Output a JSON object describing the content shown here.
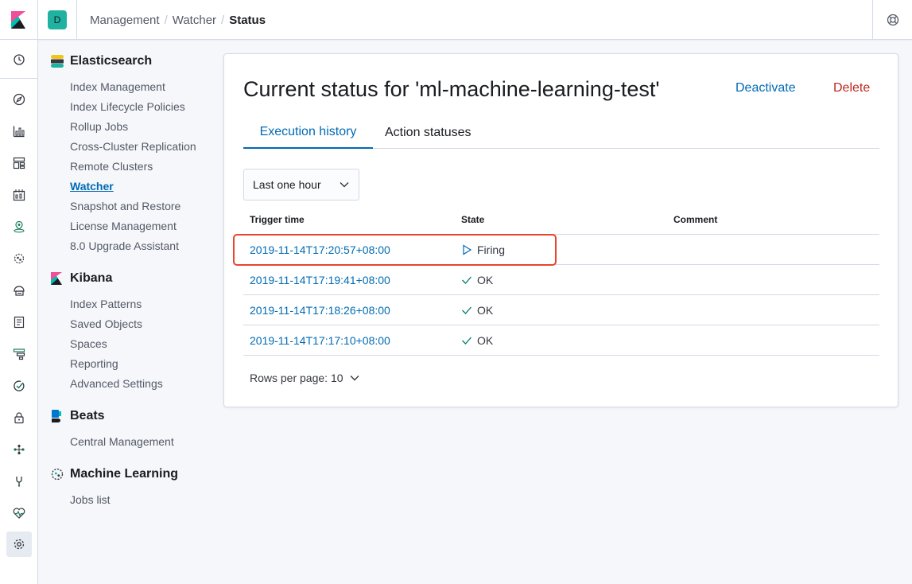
{
  "header": {
    "space_initial": "D",
    "breadcrumbs": [
      "Management",
      "Watcher",
      "Status"
    ],
    "icons": [
      "kibana-logo",
      "help-icon"
    ]
  },
  "iconnav": {
    "items": [
      "clock-icon",
      "discover-icon",
      "visualize-icon",
      "dashboard-icon",
      "canvas-icon",
      "maps-icon",
      "ml-icon",
      "infrastructure-icon",
      "logs-icon",
      "apm-icon",
      "uptime-icon",
      "siem-icon",
      "graph-icon",
      "devtools-icon",
      "monitoring-icon",
      "management-icon"
    ],
    "active": "management-icon"
  },
  "sidebar": {
    "sections": [
      {
        "title": "Elasticsearch",
        "links": [
          "Index Management",
          "Index Lifecycle Policies",
          "Rollup Jobs",
          "Cross-Cluster Replication",
          "Remote Clusters",
          "Watcher",
          "Snapshot and Restore",
          "License Management",
          "8.0 Upgrade Assistant"
        ]
      },
      {
        "title": "Kibana",
        "links": [
          "Index Patterns",
          "Saved Objects",
          "Spaces",
          "Reporting",
          "Advanced Settings"
        ]
      },
      {
        "title": "Beats",
        "links": [
          "Central Management"
        ]
      },
      {
        "title": "Machine Learning",
        "links": [
          "Jobs list"
        ]
      }
    ],
    "active_link": "Watcher"
  },
  "main": {
    "title": "Current status for 'ml-machine-learning-test'",
    "deactivate_label": "Deactivate",
    "delete_label": "Delete",
    "tabs": [
      {
        "label": "Execution history",
        "active": true
      },
      {
        "label": "Action statuses",
        "active": false
      }
    ],
    "range_select": "Last one hour",
    "table": {
      "columns": [
        "Trigger time",
        "State",
        "Comment"
      ],
      "rows": [
        {
          "trigger_time": "2019-11-14T17:20:57+08:00",
          "state": "Firing",
          "state_icon": "play-icon",
          "comment": ""
        },
        {
          "trigger_time": "2019-11-14T17:19:41+08:00",
          "state": "OK",
          "state_icon": "check-icon",
          "comment": ""
        },
        {
          "trigger_time": "2019-11-14T17:18:26+08:00",
          "state": "OK",
          "state_icon": "check-icon",
          "comment": ""
        },
        {
          "trigger_time": "2019-11-14T17:17:10+08:00",
          "state": "OK",
          "state_icon": "check-icon",
          "comment": ""
        }
      ]
    },
    "rows_per_page": "Rows per page: 10"
  },
  "colors": {
    "link": "#006bb4",
    "danger": "#bd271e",
    "highlight": "#e8452c",
    "space_avatar": "#20b2a0"
  }
}
